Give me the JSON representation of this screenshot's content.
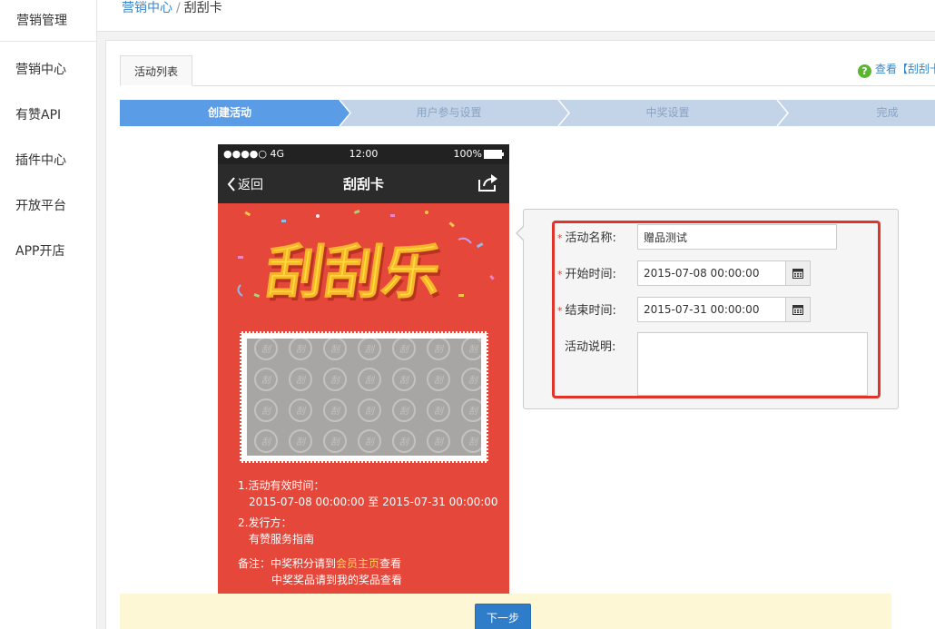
{
  "nav": {
    "header": "营销管理",
    "items": [
      {
        "label": "营销中心"
      },
      {
        "label": "有赞API"
      },
      {
        "label": "插件中心"
      },
      {
        "label": "开放平台"
      },
      {
        "label": "APP开店"
      }
    ]
  },
  "breadcrumb": {
    "parent": "营销中心",
    "separator": "/",
    "current": "刮刮卡"
  },
  "tabs": [
    {
      "label": "活动列表"
    }
  ],
  "help": {
    "icon": "question-icon",
    "text": "查看【刮刮卡"
  },
  "steps": [
    {
      "label": "创建活动",
      "active": true
    },
    {
      "label": "用户参与设置",
      "active": false
    },
    {
      "label": "中奖设置",
      "active": false
    },
    {
      "label": "完成",
      "active": false
    }
  ],
  "phone": {
    "status": {
      "signal": "●●●●○ 4G",
      "time": "12:00",
      "battery": "100%"
    },
    "back_label": "返回",
    "title": "刮刮卡",
    "banner_text": "刮刮乐",
    "scratch_glyph": "刮",
    "info": {
      "period_title": "1.活动有效时间：",
      "period_value": "2015-07-08 00:00:00 至 2015-07-31 00:00:00",
      "issuer_title": "2.发行方：",
      "issuer_value": "有赞服务指南",
      "note_label": "备注：",
      "note_line1_prefix": "中奖积分请到",
      "note_line1_link": "会员主页",
      "note_line1_suffix": "查看",
      "note_line2": "中奖奖品请到我的奖品查看"
    }
  },
  "form": {
    "name": {
      "label": "活动名称:",
      "value": "赠品测试",
      "required": true
    },
    "start": {
      "label": "开始时间:",
      "value": "2015-07-08 00:00:00",
      "required": true
    },
    "end": {
      "label": "结束时间:",
      "value": "2015-07-31 00:00:00",
      "required": true
    },
    "desc": {
      "label": "活动说明:",
      "value": "",
      "required": false
    },
    "required_mark": "*"
  },
  "footer": {
    "next_label": "下一步"
  },
  "colors": {
    "step_active": "#5b9ce6",
    "step_inactive": "#c3d3e8",
    "highlight": "#e0342a",
    "phone_bg": "#e5473a",
    "footer_bg": "#fdf7d5",
    "button": "#2f7cc9"
  }
}
